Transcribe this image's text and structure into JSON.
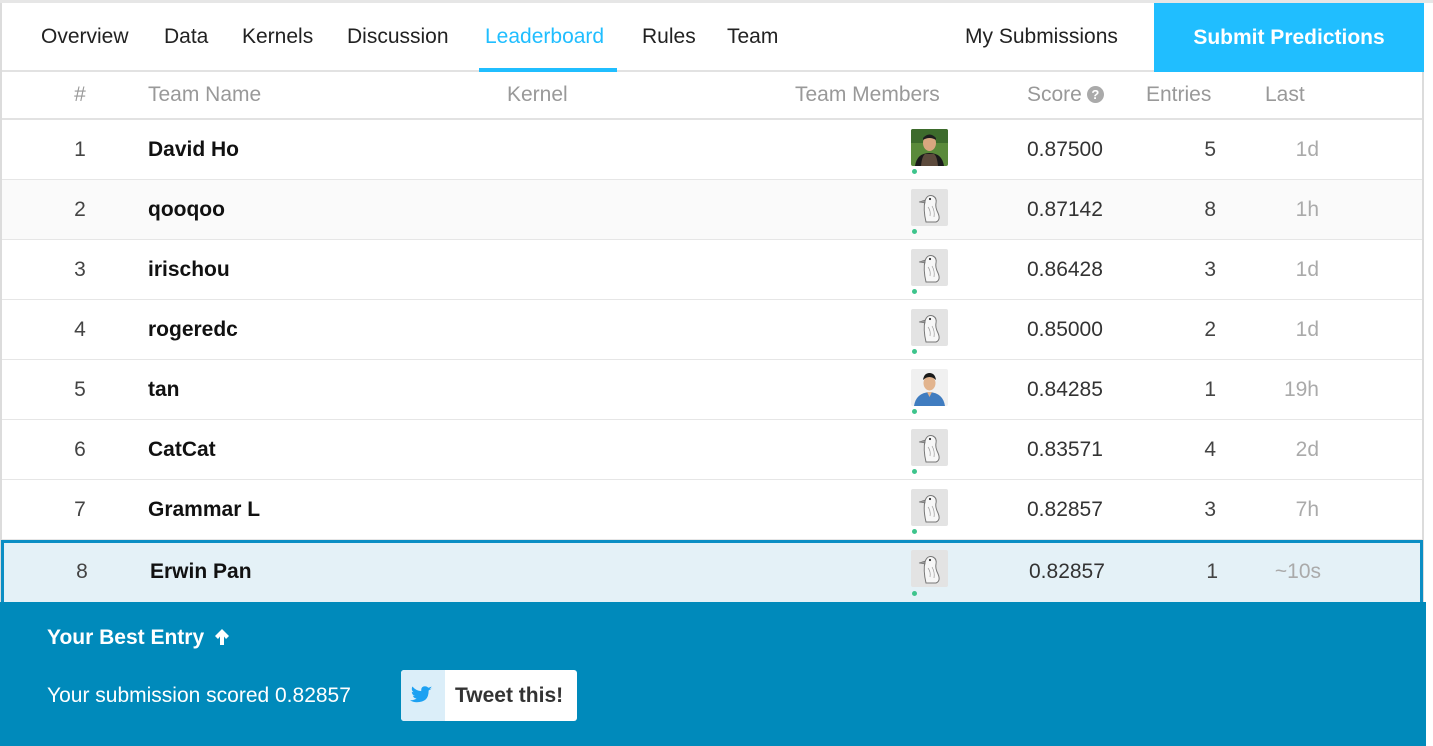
{
  "nav": {
    "tabs": [
      "Overview",
      "Data",
      "Kernels",
      "Discussion",
      "Leaderboard",
      "Rules",
      "Team"
    ],
    "active_tab": "Leaderboard",
    "my_submissions": "My Submissions",
    "submit_label": "Submit Predictions"
  },
  "table": {
    "headers": {
      "rank": "#",
      "team_name": "Team Name",
      "kernel": "Kernel",
      "team_members": "Team Members",
      "score": "Score",
      "entries": "Entries",
      "last": "Last"
    },
    "rows": [
      {
        "rank": "1",
        "team": "David Ho",
        "score": "0.87500",
        "entries": "5",
        "last": "1d",
        "avatar": "photo-black-shirt"
      },
      {
        "rank": "2",
        "team": "qooqoo",
        "score": "0.87142",
        "entries": "8",
        "last": "1h",
        "avatar": "default-goose"
      },
      {
        "rank": "3",
        "team": "irischou",
        "score": "0.86428",
        "entries": "3",
        "last": "1d",
        "avatar": "default-goose"
      },
      {
        "rank": "4",
        "team": "rogeredc",
        "score": "0.85000",
        "entries": "2",
        "last": "1d",
        "avatar": "default-goose"
      },
      {
        "rank": "5",
        "team": "tan",
        "score": "0.84285",
        "entries": "1",
        "last": "19h",
        "avatar": "photo-blue-shirt"
      },
      {
        "rank": "6",
        "team": "CatCat",
        "score": "0.83571",
        "entries": "4",
        "last": "2d",
        "avatar": "default-goose"
      },
      {
        "rank": "7",
        "team": "Grammar L",
        "score": "0.82857",
        "entries": "3",
        "last": "7h",
        "avatar": "default-goose"
      },
      {
        "rank": "8",
        "team": "Erwin Pan",
        "score": "0.82857",
        "entries": "1",
        "last": "~10s",
        "avatar": "default-goose"
      }
    ]
  },
  "best_entry": {
    "title": "Your Best Entry",
    "text": "Your submission scored 0.82857",
    "tweet_label": "Tweet this!"
  },
  "colors": {
    "accent": "#20beff",
    "panel": "#008abb",
    "highlight_row": "#e4f1f7",
    "online_dot": "#3ec48c"
  }
}
